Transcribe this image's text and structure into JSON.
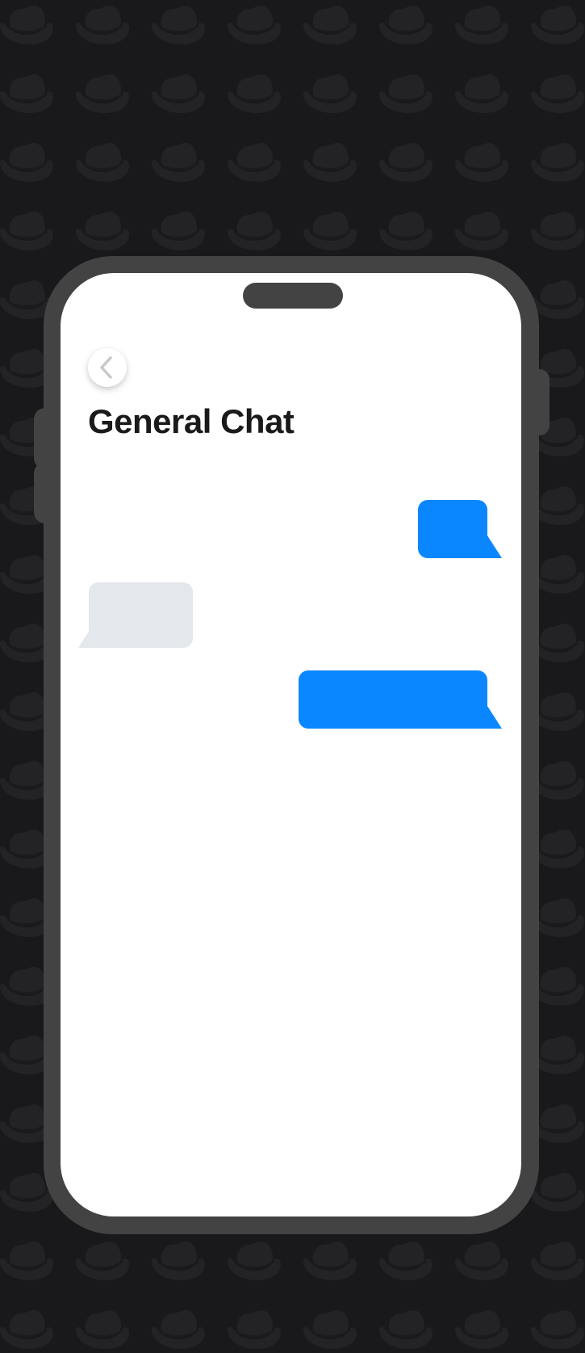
{
  "page": {
    "background_color": "#19191b",
    "pattern_icon": "fedora-hat-icon",
    "pattern_color": "#232325"
  },
  "device": {
    "frame_color": "#434343",
    "screen_color": "#ffffff"
  },
  "header": {
    "back_icon": "chevron-left-icon",
    "title": "General Chat"
  },
  "messages": [
    {
      "direction": "sent",
      "text": "",
      "color": "#0a87ff"
    },
    {
      "direction": "received",
      "text": "",
      "color": "#e4e7eb"
    },
    {
      "direction": "sent",
      "text": "",
      "color": "#0a87ff"
    }
  ]
}
